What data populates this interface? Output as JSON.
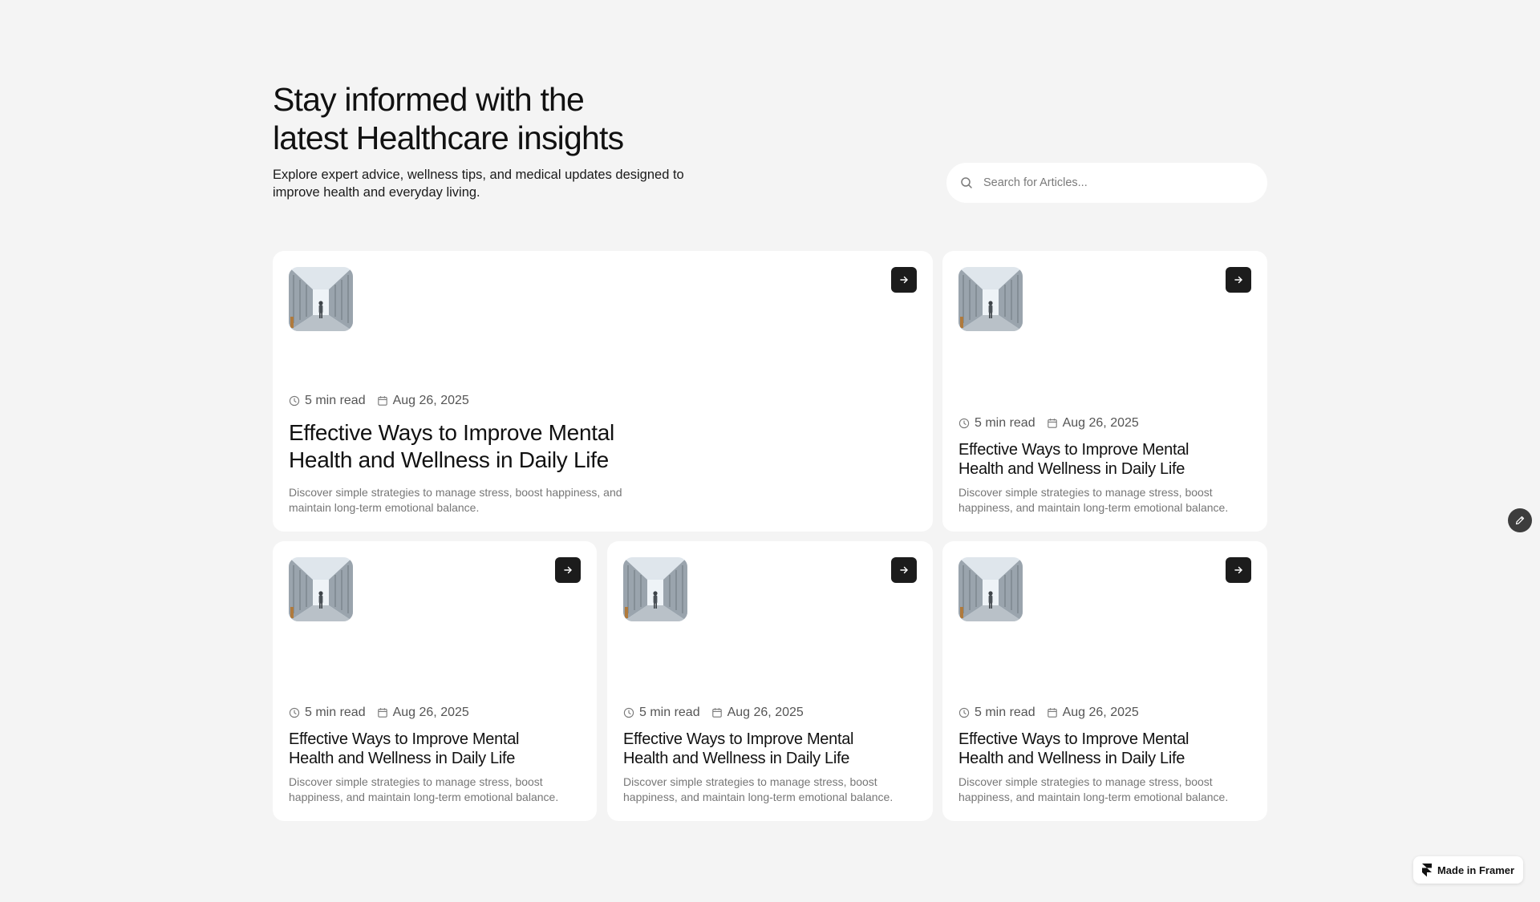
{
  "hero": {
    "title_line1": "Stay informed with the",
    "title_line2": "latest Healthcare insights",
    "subtitle_line1": "Explore expert advice, wellness tips, and medical updates designed to",
    "subtitle_line2": "improve health and everyday living."
  },
  "search": {
    "placeholder": "Search for Articles..."
  },
  "articles": [
    {
      "read_time": "5 min read",
      "date": "Aug 26, 2025",
      "title_line1": "Effective Ways to Improve Mental",
      "title_line2": "Health and Wellness in Daily Life",
      "desc_line1": "Discover simple strategies to manage stress, boost happiness, and",
      "desc_line2": "maintain long-term emotional balance."
    },
    {
      "read_time": "5 min read",
      "date": "Aug 26, 2025",
      "title_line1": "Effective Ways to Improve Mental",
      "title_line2": "Health and Wellness in Daily Life",
      "desc_line1": "Discover simple strategies to manage stress, boost",
      "desc_line2": "happiness, and maintain long-term emotional balance."
    },
    {
      "read_time": "5 min read",
      "date": "Aug 26, 2025",
      "title_line1": "Effective Ways to Improve Mental",
      "title_line2": "Health and Wellness in Daily Life",
      "desc_line1": "Discover simple strategies to manage stress, boost",
      "desc_line2": "happiness, and maintain long-term emotional balance."
    },
    {
      "read_time": "5 min read",
      "date": "Aug 26, 2025",
      "title_line1": "Effective Ways to Improve Mental",
      "title_line2": "Health and Wellness in Daily Life",
      "desc_line1": "Discover simple strategies to manage stress, boost",
      "desc_line2": "happiness, and maintain long-term emotional balance."
    },
    {
      "read_time": "5 min read",
      "date": "Aug 26, 2025",
      "title_line1": "Effective Ways to Improve Mental",
      "title_line2": "Health and Wellness in Daily Life",
      "desc_line1": "Discover simple strategies to manage stress, boost",
      "desc_line2": "happiness, and maintain long-term emotional balance."
    }
  ],
  "icons": {
    "search": "search-icon",
    "clock": "clock-icon",
    "calendar": "calendar-icon",
    "arrow": "arrow-right-icon",
    "edit": "pencil-icon",
    "framer": "framer-logo-icon"
  },
  "colors": {
    "background": "#f4f4f4",
    "card": "#ffffff",
    "button_dark": "#1c1c1c",
    "text_primary": "#111111",
    "text_muted": "#777777"
  },
  "badge": {
    "label": "Made in Framer"
  }
}
